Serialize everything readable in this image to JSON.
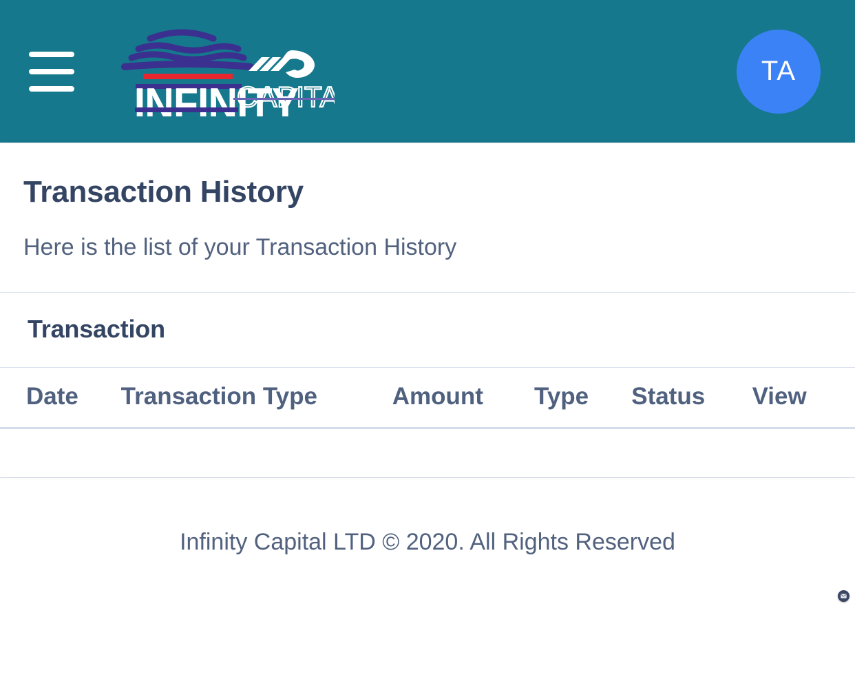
{
  "appbar": {
    "menu_icon": "hamburger-menu-icon",
    "brand": {
      "name_primary": "INFINITY",
      "name_secondary": "CAPITAL",
      "colors": {
        "teal": "#15788c",
        "purple": "#3b2f8f",
        "red": "#e8262d",
        "white": "#ffffff"
      }
    },
    "avatar": {
      "initials": "TA",
      "color": "#3b82f6"
    }
  },
  "main": {
    "title": "Transaction History",
    "subtitle": "Here is the list of your Transaction History",
    "section_title": "Transaction",
    "table": {
      "columns": [
        "Date",
        "Transaction Type",
        "Amount",
        "Type",
        "Status",
        "View"
      ],
      "rows": []
    }
  },
  "footer": {
    "text": "Infinity Capital LTD © 2020. All Rights Reserved"
  },
  "widgets": {
    "chat_icon": "envelope-icon"
  }
}
